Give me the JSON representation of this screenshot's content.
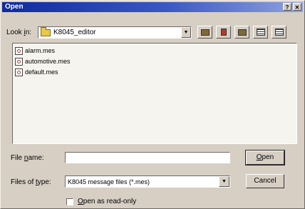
{
  "window": {
    "title": "Open",
    "help_glyph": "?",
    "close_glyph": "✕"
  },
  "lookin": {
    "label_prefix": "Look ",
    "label_underlined": "i",
    "label_suffix": "n:",
    "value": "K8045_editor",
    "arrow": "▼"
  },
  "toolbar": {
    "icons": [
      "up-folder-icon",
      "desktop-icon",
      "new-folder-icon",
      "list-view-icon",
      "details-view-icon"
    ]
  },
  "files": [
    {
      "name": "alarm.mes"
    },
    {
      "name": "automotive.mes"
    },
    {
      "name": "default.mes"
    }
  ],
  "filename": {
    "label_prefix": "File ",
    "label_underlined": "n",
    "label_suffix": "ame:",
    "value": ""
  },
  "filetype": {
    "label_prefix": "Files of ",
    "label_underlined": "t",
    "label_suffix": "ype:",
    "value": "K8045 message files (*.mes)",
    "arrow": "▼"
  },
  "buttons": {
    "open_underlined": "O",
    "open_rest": "pen",
    "cancel": "Cancel"
  },
  "readonly": {
    "label_underlined": "O",
    "label_rest": "pen as read-only",
    "checked": false
  },
  "colors": {
    "title_bar": "#0d2aa0",
    "dialog_bg": "#d7cfc4",
    "folder": "#e9c84a"
  }
}
